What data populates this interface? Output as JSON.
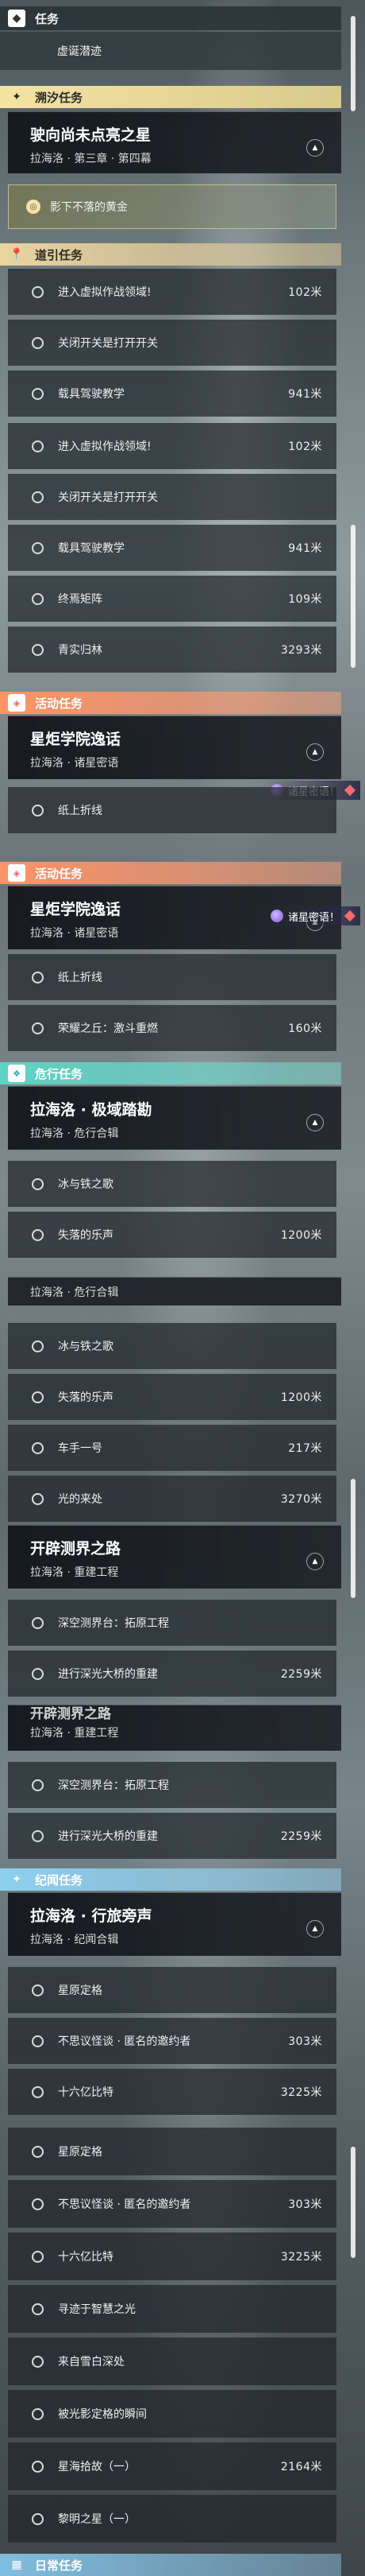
{
  "sections": {
    "task": {
      "title": "任务",
      "item": "虚诞潜迹"
    },
    "trailblaze": {
      "title": "溯汐任务",
      "quest_title": "驶向尚未点亮之星",
      "quest_sub": "拉海洛 · 第三章 · 第四幕",
      "objective": "影下不落的黄金"
    },
    "guide": {
      "title": "道引任务"
    },
    "event": {
      "title": "活动任务",
      "quest_title": "星炬学院逸话",
      "quest_sub": "拉海洛 · 诸星密语",
      "badge": "诸星密语！"
    },
    "danger": {
      "title": "危行任务",
      "quest_title": "拉海洛 · 极域踏勘",
      "quest_sub": "拉海洛 · 危行合辑"
    },
    "pioneer": {
      "quest_title": "开辟测界之路",
      "quest_sub": "拉海洛 · 重建工程"
    },
    "chronicle": {
      "title": "纪闻任务",
      "quest_title": "拉海洛 · 行旅旁声",
      "quest_sub": "拉海洛 · 纪闻合辑"
    },
    "daily": {
      "title": "日常任务"
    }
  },
  "guide_items_a": [
    {
      "label": "进入虚拟作战领域!",
      "dist": "102米"
    },
    {
      "label": "关闭开关是打开开关",
      "dist": ""
    },
    {
      "label": "载具驾驶教学",
      "dist": "941米"
    }
  ],
  "guide_items_b": [
    {
      "label": "进入虚拟作战领域!",
      "dist": "102米"
    },
    {
      "label": "关闭开关是打开开关",
      "dist": ""
    },
    {
      "label": "载具驾驶教学",
      "dist": "941米"
    },
    {
      "label": "终焉矩阵",
      "dist": "109米"
    },
    {
      "label": "青实归林",
      "dist": "3293米"
    }
  ],
  "event_items_a": [
    {
      "label": "纸上折线",
      "dist": ""
    }
  ],
  "event_items_b": [
    {
      "label": "纸上折线",
      "dist": ""
    },
    {
      "label": "荣耀之丘：激斗重燃",
      "dist": "160米"
    }
  ],
  "danger_items_a": [
    {
      "label": "冰与铁之歌",
      "dist": ""
    },
    {
      "label": "失落的乐声",
      "dist": "1200米"
    }
  ],
  "danger_sub_repeat": "拉海洛 · 危行合辑",
  "danger_items_b": [
    {
      "label": "冰与铁之歌",
      "dist": ""
    },
    {
      "label": "失落的乐声",
      "dist": "1200米"
    },
    {
      "label": "车手一号",
      "dist": "217米"
    },
    {
      "label": "光的来处",
      "dist": "3270米"
    }
  ],
  "pioneer_items": [
    {
      "label": "深空测界台：拓原工程",
      "dist": ""
    },
    {
      "label": "进行深光大桥的重建",
      "dist": "2259米"
    }
  ],
  "pioneer_repeat_title": "开辟测界之路",
  "pioneer_repeat_sub": "拉海洛 · 重建工程",
  "chronicle_items_a": [
    {
      "label": "星原定格",
      "dist": ""
    },
    {
      "label": "不思议怪谈 · 匿名的邀约者",
      "dist": "303米"
    },
    {
      "label": "十六亿比特",
      "dist": "3225米"
    }
  ],
  "chronicle_items_b": [
    {
      "label": "星原定格",
      "dist": ""
    },
    {
      "label": "不思议怪谈 · 匿名的邀约者",
      "dist": "303米"
    },
    {
      "label": "十六亿比特",
      "dist": "3225米"
    },
    {
      "label": "寻迹于智慧之光",
      "dist": ""
    },
    {
      "label": "来自雪白深处",
      "dist": ""
    },
    {
      "label": "被光影定格的瞬间",
      "dist": ""
    },
    {
      "label": "星海拾故（一）",
      "dist": "2164米"
    },
    {
      "label": "黎明之星（一）",
      "dist": ""
    }
  ],
  "colors": {
    "trailblaze": "#f4e3a3",
    "guide": "#f1d9a3",
    "event": "#ffb28c",
    "danger": "#8ae4d6",
    "chronicle": "#9ed8f2"
  }
}
